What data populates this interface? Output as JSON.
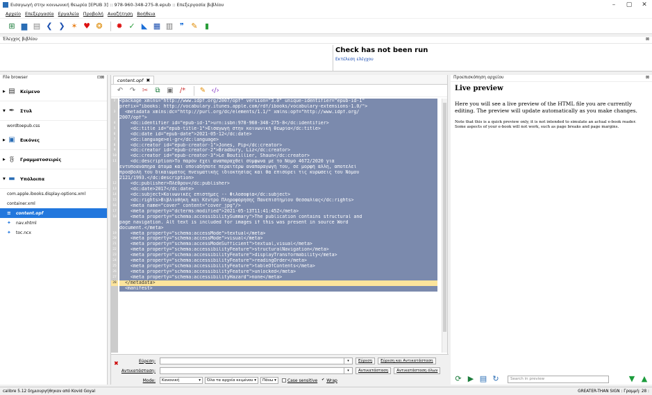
{
  "window": {
    "title": "Εισαγωγή στην κοινωνική θεωρία [EPUB 3] :: 978-960-348-275-8.epub :: Επεξεργασία βιβλίου",
    "min": "–",
    "max": "▢",
    "close": "✕"
  },
  "menu": [
    "Αρχείο",
    "Επεξεργασία",
    "Εργαλεία",
    "Προβολή",
    "Αναζήτηση",
    "Βοήθεια"
  ],
  "check": {
    "header": "Έλεγχος βιβλίου",
    "title": "Check has not been run",
    "link": "Εκτέλεση ελέγχου"
  },
  "filebrowser": {
    "header": "File browser",
    "groups": {
      "text": "Κείμενο",
      "styles": "Στυλ",
      "images": "Εικόνες",
      "fonts": "Γραμματοσειρές",
      "misc": "Υπόλοιπα"
    },
    "styles_files": [
      "wordtoepub.css"
    ],
    "misc_files": [
      "com.apple.ibooks.display-options.xml",
      "container.xml",
      "content.opf",
      "nav.xhtml",
      "toc.ncx"
    ]
  },
  "editor": {
    "tab": "content.opf",
    "lines": [
      {
        "n": "2",
        "t": "<package xmlns=\"http://www.idpf.org/2007/opf\" version=\"3.0\" unique-identifier=\"epub-id-1\""
      },
      {
        "n": "",
        "t": "prefix=\"ibooks: http://vocabulary.itunes.apple.com/rdf/ibooks/vocabulary-extensions-1.0/\">"
      },
      {
        "n": "3",
        "t": "  <metadata xmlns:dc=\"http://purl.org/dc/elements/1.1/\" xmlns:opf=\"http://www.idpf.org/"
      },
      {
        "n": "",
        "t": "2007/opf\">"
      },
      {
        "n": "4",
        "t": "    <dc:identifier id=\"epub-id-1\">urn:isbn:978-960-348-275-8</dc:identifier>"
      },
      {
        "n": "5",
        "t": "    <dc:title id=\"epub-title-1\">Εισαγωγή στην κοινωνική θεωρία</dc:title>"
      },
      {
        "n": "6",
        "t": "    <dc:date id=\"epub-date\">2021-05-12</dc:date>"
      },
      {
        "n": "7",
        "t": "    <dc:language>el-gr</dc:language>"
      },
      {
        "n": "8",
        "t": "    <dc:creator id=\"epub-creator-1\">Jones, Pip</dc:creator>"
      },
      {
        "n": "9",
        "t": "    <dc:creator id=\"epub-creator-2\">Bradbury, Liz</dc:creator>"
      },
      {
        "n": "10",
        "t": "    <dc:creator id=\"epub-creator-3\">Le Boutillier, Shaun</dc:creator>"
      },
      {
        "n": "11",
        "t": "    <dc:description>Το παρόν έχει αναπαραχθεί σύμφωνα με το Νόμο 4672/2020 για"
      },
      {
        "n": "",
        "t": "εντυποανάπηρα άτομα και οποιαδήποτε περαιτέρω αναπαραγωγή του, σε μορφή άλλη, αποτελεί"
      },
      {
        "n": "",
        "t": "προσβολή του δικαιώματος πνευματικής ιδιοκτησίας και θα επισύρει τις κυρώσεις του Νόμου"
      },
      {
        "n": "",
        "t": "2121/1993.</dc:description>"
      },
      {
        "n": "12",
        "t": "    <dc:publisher>Πλέθρον</dc:publisher>"
      },
      {
        "n": "13",
        "t": "    <dc:date>2017</dc:date>"
      },
      {
        "n": "14",
        "t": "    <dc:subject>Κοινωνικές επιστήμες -- Φιλοσοφία</dc:subject>"
      },
      {
        "n": "15",
        "t": "    <dc:rights>Βιβλιοθήκη και Κέντρο Πληροφόρησης Πανεπιστημίου Θεσσαλίας</dc:rights>"
      },
      {
        "n": "16",
        "t": "    <meta name=\"cover\" content=\"cover_jpg\"/>"
      },
      {
        "n": "17",
        "t": "    <meta property=\"dcterms:modified\">2021-05-13T11:41:45Z</meta>"
      },
      {
        "n": "18",
        "t": "    <meta property=\"schema:accessibilitySummary\">The publication contains structural and"
      },
      {
        "n": "",
        "t": "page navigation. Alt text is included for images if this was present in source Word"
      },
      {
        "n": "",
        "t": "document.</meta>"
      },
      {
        "n": "19",
        "t": "    <meta property=\"schema:accessMode\">textual</meta>"
      },
      {
        "n": "20",
        "t": "    <meta property=\"schema:accessMode\">visual</meta>"
      },
      {
        "n": "21",
        "t": "    <meta property=\"schema:accessModeSufficient\">textual,visual</meta>"
      },
      {
        "n": "22",
        "t": "    <meta property=\"schema:accessibilityFeature\">structuralNavigation</meta>"
      },
      {
        "n": "23",
        "t": "    <meta property=\"schema:accessibilityFeature\">displayTransformability</meta>"
      },
      {
        "n": "24",
        "t": "    <meta property=\"schema:accessibilityFeature\">readingOrder</meta>"
      },
      {
        "n": "25",
        "t": "    <meta property=\"schema:accessibilityFeature\">tableOfContents</meta>"
      },
      {
        "n": "26",
        "t": "    <meta property=\"schema:accessibilityFeature\">unlocked</meta>"
      },
      {
        "n": "27",
        "t": "    <meta property=\"schema:accessibilityHazard\">none</meta>"
      },
      {
        "n": "28",
        "t": "  </metadata>"
      },
      {
        "n": "",
        "t": "  <manifest>"
      }
    ],
    "current_line": "28"
  },
  "find": {
    "find_label": "Εύρεση:",
    "replace_label": "Αντικατάσταση:",
    "mode_label": "Mode:",
    "mode_value": "Κανονική",
    "scope_value": "Όλα τα αρχεία κειμένου",
    "direction_value": "Πάνω",
    "case_label": "Case sensitive",
    "wrap_label": "Wrap",
    "btn_find": "Εύρεση",
    "btn_find_replace": "Εύρεση και Αντικατάσταση",
    "btn_replace": "Αντικατάσταση",
    "btn_replace_all": "Αντικατάσταση όλων"
  },
  "preview": {
    "header": "Προεπισκόπηση αρχείου",
    "title": "Live preview",
    "text1": "Here you will see a live preview of the HTML file you are currently editing. The preview will update automatically as you make changes.",
    "text2": "Note that this is a quick preview only, it is not intended to simulate an actual e-book reader. Some aspects of your e-book will not work, such as page breaks and page margins.",
    "search_placeholder": "Search in preview"
  },
  "status": {
    "left": "calibre 5.12 δημιουργήθηκαν από Kovid Goyal",
    "right": "GREATER-THAN SIGN : Γραμμή: 28 :"
  },
  "colors": {
    "selection": "#7b8aad",
    "current_line": "#fce49c",
    "accent": "#2277dd"
  }
}
